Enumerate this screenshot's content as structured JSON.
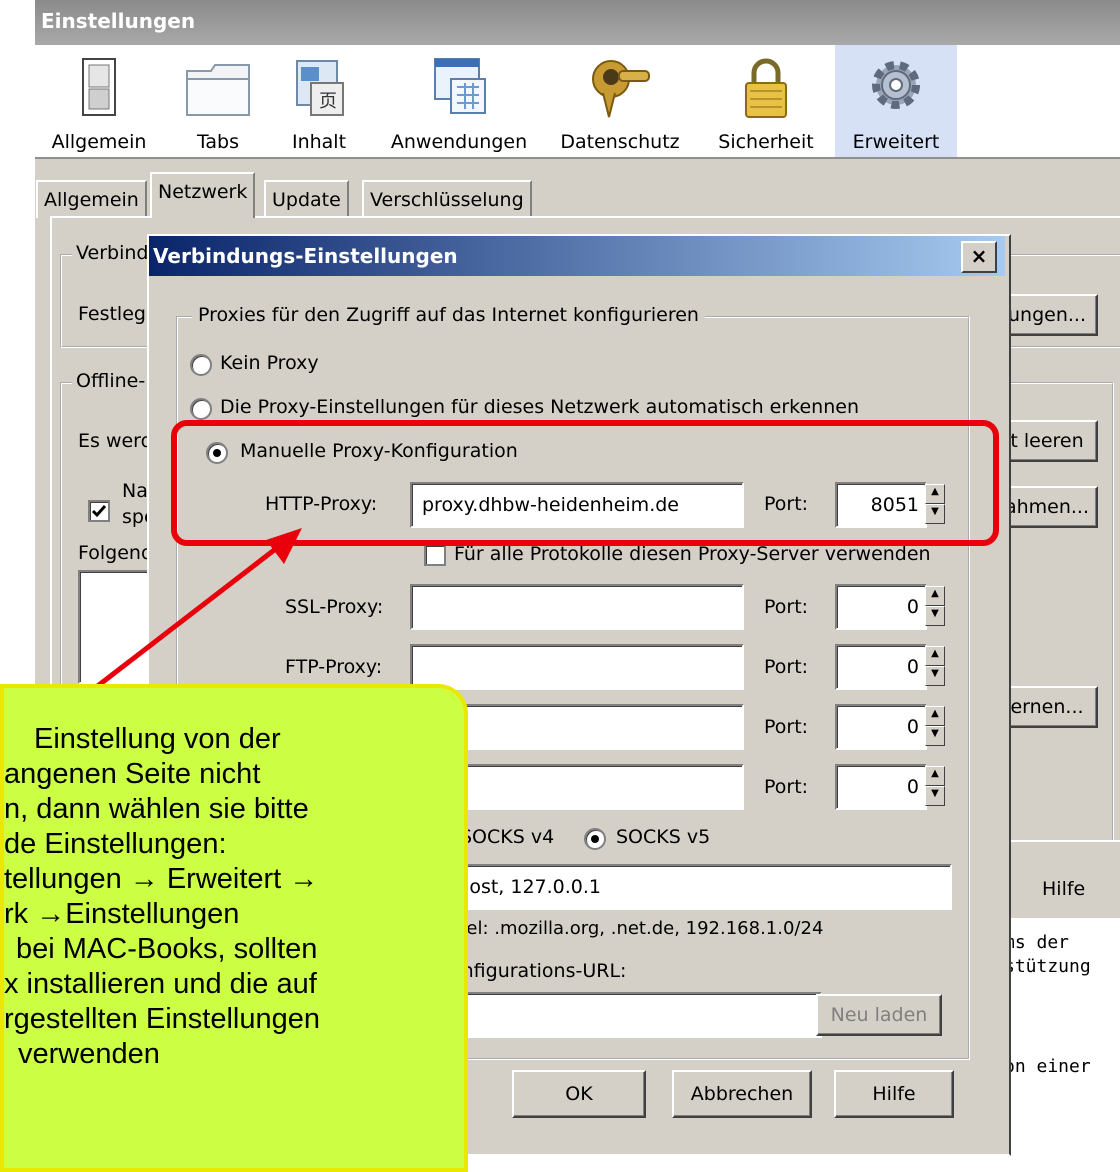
{
  "window": {
    "title": "Einstellungen"
  },
  "toolbar": {
    "items": [
      {
        "label": "Allgemein",
        "icon": "switch-icon"
      },
      {
        "label": "Tabs",
        "icon": "folder-icon"
      },
      {
        "label": "Inhalt",
        "icon": "content-icon"
      },
      {
        "label": "Anwendungen",
        "icon": "applications-icon"
      },
      {
        "label": "Datenschutz",
        "icon": "mask-icon"
      },
      {
        "label": "Sicherheit",
        "icon": "lock-icon"
      },
      {
        "label": "Erweitert",
        "icon": "gear-icon"
      }
    ]
  },
  "tabs": [
    "Allgemein",
    "Netzwerk",
    "Update",
    "Verschlüsselung"
  ],
  "background": {
    "group1_legend": "Verbind",
    "row1_label": "Festleg",
    "settings_button": "ungen...",
    "group2_legend": "Offline-",
    "row2_label": "Es werd",
    "clear_button": "t leeren",
    "checkbox_label_line1": "Na",
    "checkbox_label_line2": "spe",
    "exceptions_button": "ahmen...",
    "row3_label": "Folgend",
    "remove_button": "ernen...",
    "help_button": "Hilfe",
    "text_line1": "ms   der",
    "text_line2": "stützung",
    "text_line3": ".",
    "text_line4": "on einer"
  },
  "dialog": {
    "title": "Verbindungs-Einstellungen",
    "close": "×",
    "group_legend": "Proxies für den Zugriff auf das Internet konfigurieren",
    "opt_none": "Kein Proxy",
    "opt_auto": "Die Proxy-Einstellungen für dieses Netzwerk automatisch erkennen",
    "opt_manual": "Manuelle Proxy-Konfiguration",
    "http_label": "HTTP-Proxy:",
    "http_value": "proxy.dhbw-heidenheim.de",
    "http_port_label": "Port:",
    "http_port": "8051",
    "all_protocols": "Für alle Protokolle diesen Proxy-Server verwenden",
    "ssl_label": "SSL-Proxy:",
    "ssl_port_label": "Port:",
    "ssl_port": "0",
    "ftp_label": "FTP-Proxy:",
    "ftp_port_label": "Port:",
    "ftp_port": "0",
    "gopher_port_label": "Port:",
    "gopher_port": "0",
    "socks_port_label": "Port:",
    "socks_port": "0",
    "socks_v4": "SOCKS v4",
    "socks_v5": "SOCKS v5",
    "no_proxy_value": "lhost, 127.0.0.1",
    "example": "piel: .mozilla.org, .net.de, 192.168.1.0/24",
    "auto_url_label": "onfigurations-URL:",
    "reload_button": "Neu laden",
    "ok_button": "OK",
    "cancel_button": "Abbrechen",
    "help_button": "Hilfe"
  },
  "callout": {
    "lines": [
      "Einstellung von der",
      "angenen Seite nicht",
      "n, dann wählen sie bitte",
      "de Einstellungen:",
      "tellungen → Erweitert →",
      "rk →Einstellungen",
      "bei MAC-Books, sollten",
      "x installieren und die auf",
      "rgestellten Einstellungen",
      "verwenden"
    ]
  },
  "colors": {
    "highlight": "#e8000a",
    "callout_bg": "#ccff44",
    "dialog_title": "#0a246a"
  }
}
